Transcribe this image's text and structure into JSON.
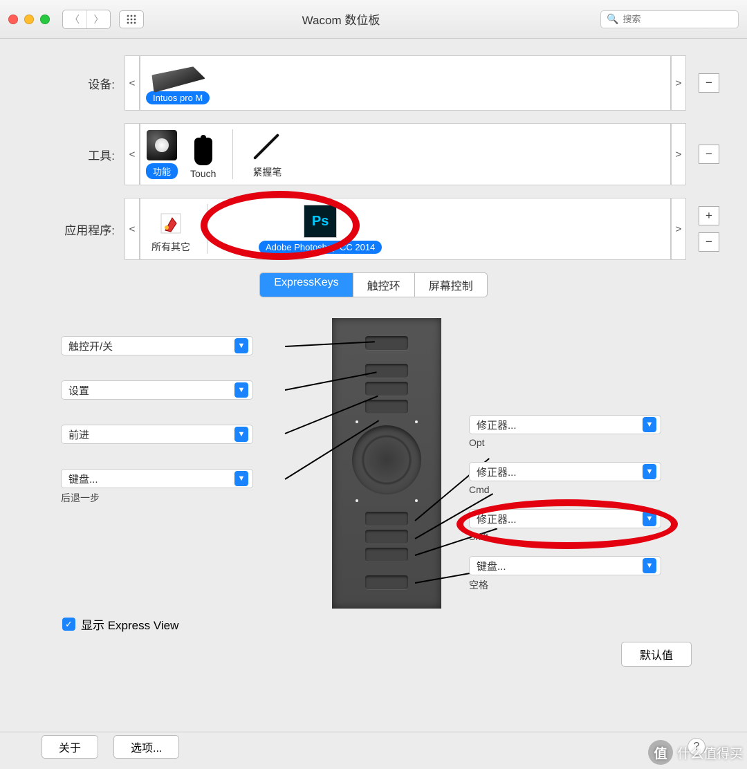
{
  "window": {
    "title": "Wacom 数位板",
    "search_placeholder": "搜索"
  },
  "rows": {
    "device": {
      "label": "设备:",
      "item": "Intuos pro M"
    },
    "tool": {
      "label": "工具:",
      "items": [
        "功能",
        "Touch",
        "紧握笔"
      ]
    },
    "app": {
      "label": "应用程序:",
      "items": [
        "所有其它",
        "Adobe Photoshop CC 2014"
      ]
    }
  },
  "tabs": [
    "ExpressKeys",
    "触控环",
    "屏幕控制"
  ],
  "left_keys": [
    {
      "label": "触控开/关",
      "sub": ""
    },
    {
      "label": "设置",
      "sub": ""
    },
    {
      "label": "前进",
      "sub": ""
    },
    {
      "label": "键盘...",
      "sub": "后退一步"
    }
  ],
  "right_keys": [
    {
      "label": "修正器...",
      "sub": "Opt"
    },
    {
      "label": "修正器...",
      "sub": "Cmd"
    },
    {
      "label": "修正器...",
      "sub": "Shift"
    },
    {
      "label": "键盘...",
      "sub": "空格"
    }
  ],
  "express_view": {
    "label": "显示 Express View",
    "checked": true
  },
  "buttons": {
    "default": "默认值",
    "about": "关于",
    "options": "选项..."
  },
  "watermark": "什么值得买"
}
